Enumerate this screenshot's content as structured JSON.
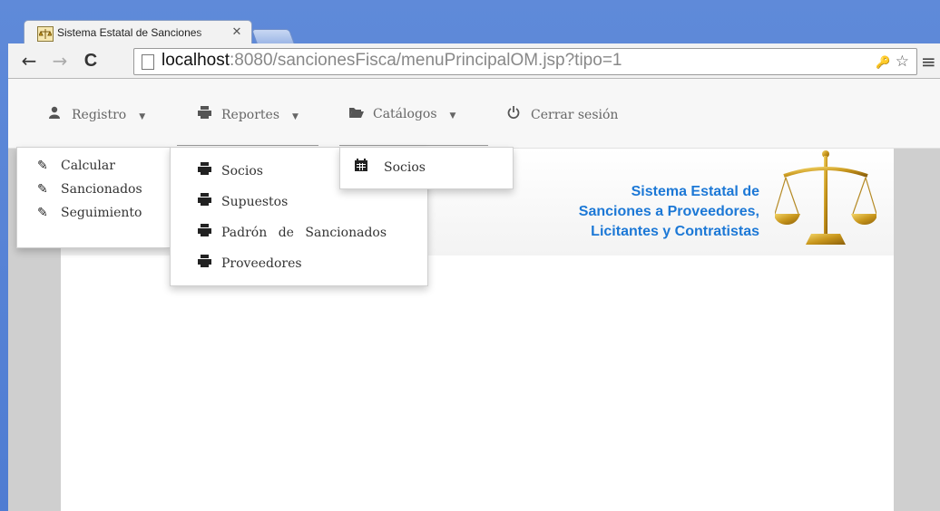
{
  "browser": {
    "tab_title": "Sistema Estatal de Sanciones",
    "tab_close": "✕",
    "back": "←",
    "forward": "→",
    "reload": "C",
    "url_host": "localhost",
    "url_rest": ":8080/sancionesFisca/menuPrincipalOM.jsp?tipo=1",
    "key_glyph": "🔑",
    "star_glyph": "☆",
    "menu_glyph": "≡"
  },
  "navbar": {
    "items": [
      {
        "label": "Registro",
        "icon": "user-icon"
      },
      {
        "label": "Reportes",
        "icon": "print-icon"
      },
      {
        "label": "Catálogos",
        "icon": "folder-open-icon"
      },
      {
        "label": "Cerrar sesión",
        "icon": "power-icon"
      }
    ]
  },
  "menus": {
    "registro": [
      "Calcular",
      "Sancionados",
      "Seguimiento"
    ],
    "reportes": [
      "Socios",
      "Supuestos",
      "Padrón de Sancionados",
      "Proveedores"
    ],
    "catalogos": [
      "Socios"
    ]
  },
  "banner": {
    "line1": "Sistema Estatal de",
    "line2": "Sanciones a Proveedores,",
    "line3": "Licitantes y Contratistas"
  },
  "colors": {
    "chrome_blue": "#5a84d6",
    "banner_text": "#1c78d6"
  }
}
